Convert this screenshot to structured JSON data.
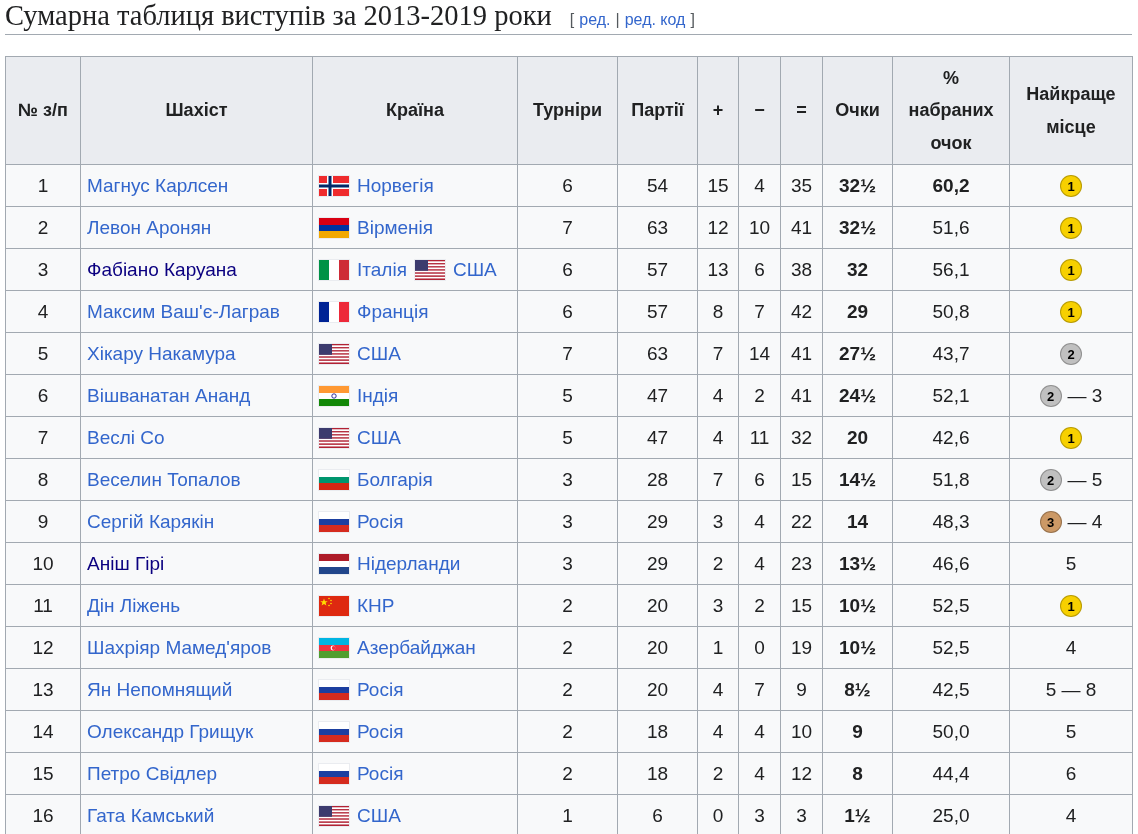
{
  "heading": {
    "title": "Сумарна таблиця виступів за 2013-2019 роки",
    "edit_section": {
      "open": "[",
      "links": [
        "ред.",
        "ред. код"
      ],
      "separator": "|",
      "close": "]"
    }
  },
  "table": {
    "columns": [
      "№ з/п",
      "Шахіст",
      "Країна",
      "Турніри",
      "Партії",
      "+",
      "−",
      "=",
      "Очки",
      "% набраних очок",
      "Найкраще місце"
    ],
    "rows": [
      {
        "no": "1",
        "player": {
          "name": "Магнус Карлсен",
          "visited": false
        },
        "countries": [
          {
            "kind": "norway",
            "name": "Норвегія"
          }
        ],
        "tournaments": "6",
        "games": "54",
        "wins": "15",
        "losses": "4",
        "draws": "35",
        "points": "32½",
        "percent": {
          "value": "60,2",
          "bold": true
        },
        "best": {
          "badge": "1",
          "color": "#f7d000"
        }
      },
      {
        "no": "2",
        "player": {
          "name": "Левон Аронян",
          "visited": false
        },
        "countries": [
          {
            "kind": "armenia",
            "name": "Вірменія"
          }
        ],
        "tournaments": "7",
        "games": "63",
        "wins": "12",
        "losses": "10",
        "draws": "41",
        "points": "32½",
        "percent": {
          "value": "51,6",
          "bold": false
        },
        "best": {
          "badge": "1",
          "color": "#f7d000"
        }
      },
      {
        "no": "3",
        "player": {
          "name": "Фабіано Каруана",
          "visited": true
        },
        "countries": [
          {
            "kind": "italy",
            "name": "Італія"
          },
          {
            "kind": "usa",
            "name": "США"
          }
        ],
        "tournaments": "6",
        "games": "57",
        "wins": "13",
        "losses": "6",
        "draws": "38",
        "points": "32",
        "percent": {
          "value": "56,1",
          "bold": false
        },
        "best": {
          "badge": "1",
          "color": "#f7d000"
        }
      },
      {
        "no": "4",
        "player": {
          "name": "Максим Ваш'є-Лаграв",
          "visited": false
        },
        "countries": [
          {
            "kind": "france",
            "name": "Франція"
          }
        ],
        "tournaments": "6",
        "games": "57",
        "wins": "8",
        "losses": "7",
        "draws": "42",
        "points": "29",
        "percent": {
          "value": "50,8",
          "bold": false
        },
        "best": {
          "badge": "1",
          "color": "#f7d000"
        }
      },
      {
        "no": "5",
        "player": {
          "name": "Хікару Накамура",
          "visited": false
        },
        "countries": [
          {
            "kind": "usa",
            "name": "США"
          }
        ],
        "tournaments": "7",
        "games": "63",
        "wins": "7",
        "losses": "14",
        "draws": "41",
        "points": "27½",
        "percent": {
          "value": "43,7",
          "bold": false
        },
        "best": {
          "badge": "2",
          "color": "#c0c0c0"
        }
      },
      {
        "no": "6",
        "player": {
          "name": "Вішванатан Ананд",
          "visited": false
        },
        "countries": [
          {
            "kind": "india",
            "name": "Індія"
          }
        ],
        "tournaments": "5",
        "games": "47",
        "wins": "4",
        "losses": "2",
        "draws": "41",
        "points": "24½",
        "percent": {
          "value": "52,1",
          "bold": false
        },
        "best": {
          "badge": "2",
          "color": "#c0c0c0",
          "text": "— 3"
        }
      },
      {
        "no": "7",
        "player": {
          "name": "Веслі Со",
          "visited": false
        },
        "countries": [
          {
            "kind": "usa",
            "name": "США"
          }
        ],
        "tournaments": "5",
        "games": "47",
        "wins": "4",
        "losses": "11",
        "draws": "32",
        "points": "20",
        "percent": {
          "value": "42,6",
          "bold": false
        },
        "best": {
          "badge": "1",
          "color": "#f7d000"
        }
      },
      {
        "no": "8",
        "player": {
          "name": "Веселин Топалов",
          "visited": false
        },
        "countries": [
          {
            "kind": "bulgaria",
            "name": "Болгарія"
          }
        ],
        "tournaments": "3",
        "games": "28",
        "wins": "7",
        "losses": "6",
        "draws": "15",
        "points": "14½",
        "percent": {
          "value": "51,8",
          "bold": false
        },
        "best": {
          "badge": "2",
          "color": "#c0c0c0",
          "text": "— 5"
        }
      },
      {
        "no": "9",
        "player": {
          "name": "Сергій Карякін",
          "visited": false
        },
        "countries": [
          {
            "kind": "russia",
            "name": "Росія"
          }
        ],
        "tournaments": "3",
        "games": "29",
        "wins": "3",
        "losses": "4",
        "draws": "22",
        "points": "14",
        "percent": {
          "value": "48,3",
          "bold": false
        },
        "best": {
          "badge": "3",
          "color": "#cc9966",
          "text": "— 4"
        }
      },
      {
        "no": "10",
        "player": {
          "name": "Аніш Гірі",
          "visited": true
        },
        "countries": [
          {
            "kind": "netherlands",
            "name": "Нідерланди"
          }
        ],
        "tournaments": "3",
        "games": "29",
        "wins": "2",
        "losses": "4",
        "draws": "23",
        "points": "13½",
        "percent": {
          "value": "46,6",
          "bold": false
        },
        "best": {
          "text": "5"
        }
      },
      {
        "no": "11",
        "player": {
          "name": "Дін Ліжень",
          "visited": false
        },
        "countries": [
          {
            "kind": "china",
            "name": "КНР"
          }
        ],
        "tournaments": "2",
        "games": "20",
        "wins": "3",
        "losses": "2",
        "draws": "15",
        "points": "10½",
        "percent": {
          "value": "52,5",
          "bold": false
        },
        "best": {
          "badge": "1",
          "color": "#f7d000"
        }
      },
      {
        "no": "12",
        "player": {
          "name": "Шахріяр Мамед'яров",
          "visited": false
        },
        "countries": [
          {
            "kind": "azerbaijan",
            "name": "Азербайджан"
          }
        ],
        "tournaments": "2",
        "games": "20",
        "wins": "1",
        "losses": "0",
        "draws": "19",
        "points": "10½",
        "percent": {
          "value": "52,5",
          "bold": false
        },
        "best": {
          "text": "4"
        }
      },
      {
        "no": "13",
        "player": {
          "name": "Ян Непомнящий",
          "visited": false
        },
        "countries": [
          {
            "kind": "russia",
            "name": "Росія"
          }
        ],
        "tournaments": "2",
        "games": "20",
        "wins": "4",
        "losses": "7",
        "draws": "9",
        "points": "8½",
        "percent": {
          "value": "42,5",
          "bold": false
        },
        "best": {
          "text": "5 — 8"
        }
      },
      {
        "no": "14",
        "player": {
          "name": "Олександр Грищук",
          "visited": false
        },
        "countries": [
          {
            "kind": "russia",
            "name": "Росія"
          }
        ],
        "tournaments": "2",
        "games": "18",
        "wins": "4",
        "losses": "4",
        "draws": "10",
        "points": "9",
        "percent": {
          "value": "50,0",
          "bold": false
        },
        "best": {
          "text": "5"
        }
      },
      {
        "no": "15",
        "player": {
          "name": "Петро Свідлер",
          "visited": false
        },
        "countries": [
          {
            "kind": "russia",
            "name": "Росія"
          }
        ],
        "tournaments": "2",
        "games": "18",
        "wins": "2",
        "losses": "4",
        "draws": "12",
        "points": "8",
        "percent": {
          "value": "44,4",
          "bold": false
        },
        "best": {
          "text": "6"
        }
      },
      {
        "no": "16",
        "player": {
          "name": "Гата Камський",
          "visited": false
        },
        "countries": [
          {
            "kind": "usa",
            "name": "США"
          }
        ],
        "tournaments": "1",
        "games": "6",
        "wins": "0",
        "losses": "3",
        "draws": "3",
        "points": "1½",
        "percent": {
          "value": "25,0",
          "bold": false
        },
        "best": {
          "text": "4"
        }
      }
    ]
  }
}
